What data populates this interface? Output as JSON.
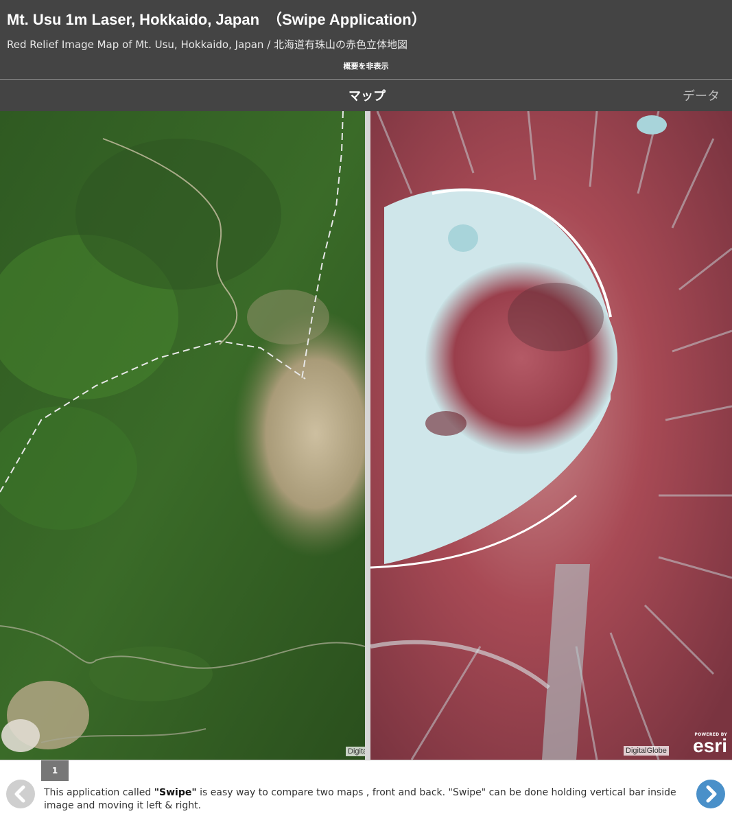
{
  "header": {
    "title": "Mt. Usu 1m Laser, Hokkaido, Japan　（Swipe Application）",
    "subtitle": "Red Relief Image Map of Mt. Usu, Hokkaido, Japan / 北海道有珠山の赤色立体地図",
    "toggle_summary": "概要を非表示"
  },
  "tabs": [
    {
      "label": "マップ",
      "active": true
    },
    {
      "label": "データ",
      "active": false
    }
  ],
  "map": {
    "attribution_left": "DigitalGlobe",
    "attribution_right": "DigitalGlobe",
    "esri_powered": "POWERED BY",
    "esri_name": "esri"
  },
  "footer": {
    "page_number": "1",
    "description_prefix": "This application called ",
    "description_bold": "\"Swipe\"",
    "description_suffix": " is easy way to compare two maps , front and back. \"Swipe\" can be done holding vertical bar inside image and moving it left & right."
  },
  "colors": {
    "header_bg": "#444444",
    "next_button": "#4a90c9",
    "prev_button": "#cfcfcf"
  }
}
